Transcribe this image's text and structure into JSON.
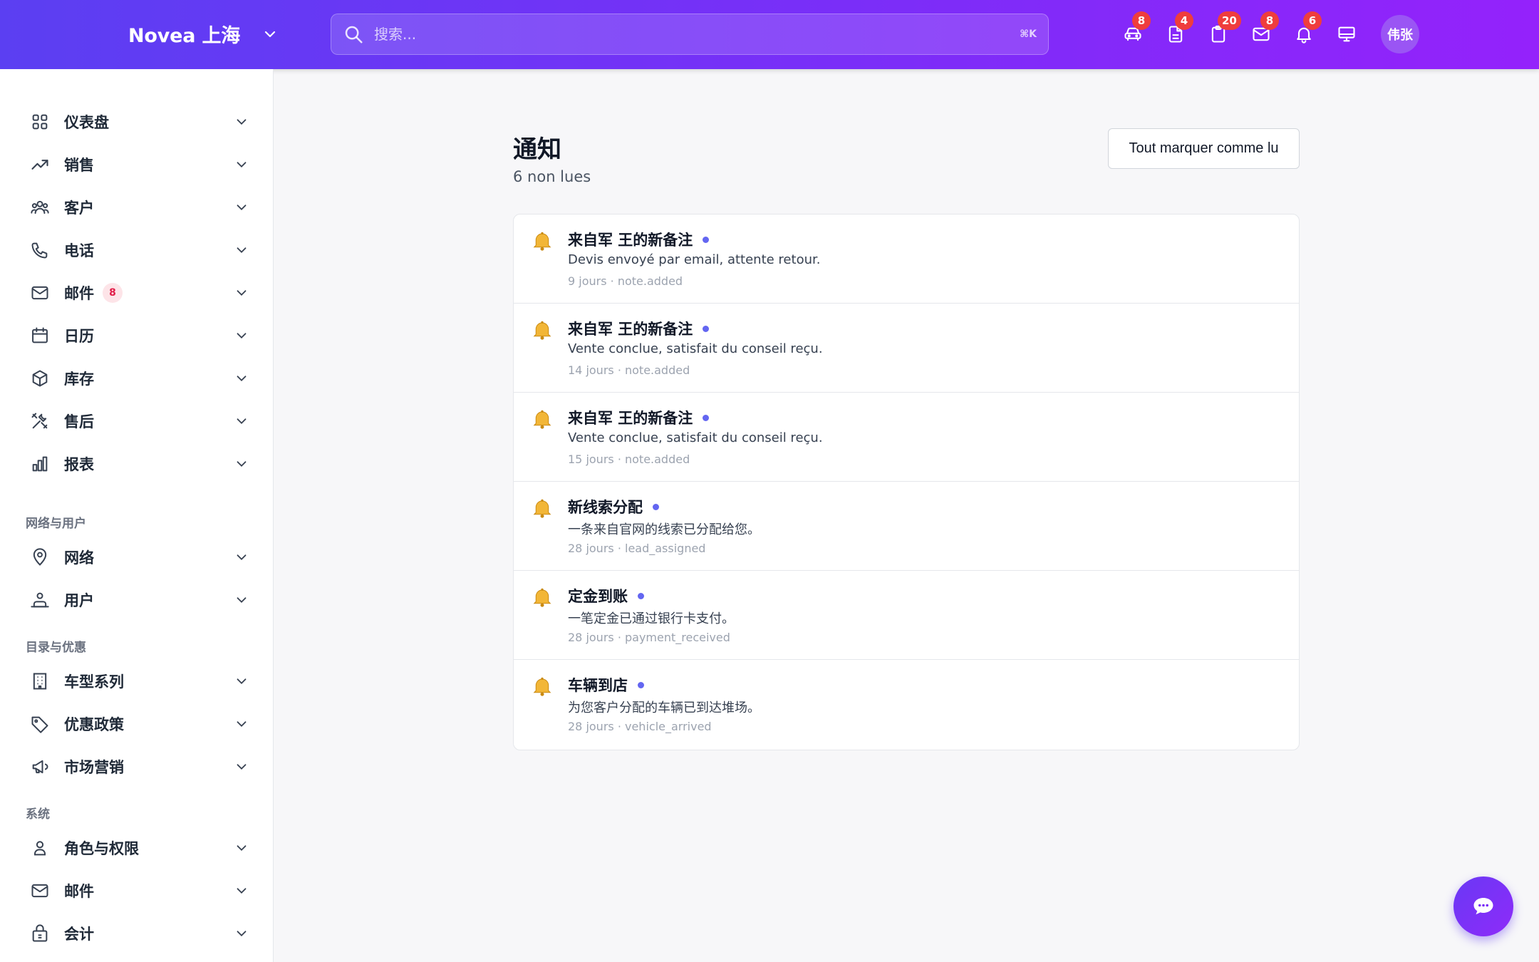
{
  "header": {
    "brand": "Novea 上海",
    "search_placeholder": "搜索...",
    "search_shortcut": "⌘K",
    "icons": [
      {
        "name": "car-icon",
        "badge": "8"
      },
      {
        "name": "document-icon",
        "badge": "4"
      },
      {
        "name": "clipboard-icon",
        "badge": "20"
      },
      {
        "name": "mail-icon",
        "badge": "8"
      },
      {
        "name": "bell-icon",
        "badge": "6"
      },
      {
        "name": "monitor-icon",
        "badge": ""
      }
    ],
    "avatar": "伟张"
  },
  "sidebar": {
    "items": [
      {
        "label": "仪表盘",
        "icon": "grid-icon"
      },
      {
        "label": "销售",
        "icon": "trending-icon"
      },
      {
        "label": "客户",
        "icon": "users-icon"
      },
      {
        "label": "电话",
        "icon": "phone-icon"
      },
      {
        "label": "邮件",
        "icon": "mail-icon",
        "badge": "8"
      },
      {
        "label": "日历",
        "icon": "calendar-icon"
      },
      {
        "label": "库存",
        "icon": "box-icon"
      },
      {
        "label": "售后",
        "icon": "tools-icon"
      },
      {
        "label": "报表",
        "icon": "bar-chart-icon"
      }
    ],
    "section_network": "网络与用户",
    "network_items": [
      {
        "label": "网络",
        "icon": "map-pin-icon"
      },
      {
        "label": "用户",
        "icon": "user-group-icon"
      }
    ],
    "section_catalog": "目录与优惠",
    "catalog_items": [
      {
        "label": "车型系列",
        "icon": "building-icon"
      },
      {
        "label": "优惠政策",
        "icon": "tag-icon"
      },
      {
        "label": "市场营销",
        "icon": "megaphone-icon"
      }
    ],
    "section_system": "系统",
    "system_items": [
      {
        "label": "角色与权限",
        "icon": "user-icon"
      },
      {
        "label": "邮件",
        "icon": "mail-icon"
      },
      {
        "label": "会计",
        "icon": "lock-bag-icon"
      }
    ]
  },
  "main": {
    "title": "通知",
    "subtitle": "6 non lues",
    "mark_all_button": "Tout marquer comme lu",
    "notifications": [
      {
        "title": "来自军 王的新备注",
        "body": "Devis envoyé par email, attente retour.",
        "meta": "9 jours · note.added"
      },
      {
        "title": "来自军 王的新备注",
        "body": "Vente conclue, satisfait du conseil reçu.",
        "meta": "14 jours · note.added"
      },
      {
        "title": "来自军 王的新备注",
        "body": "Vente conclue, satisfait du conseil reçu.",
        "meta": "15 jours · note.added"
      },
      {
        "title": "新线索分配",
        "body": "一条来自官网的线索已分配给您。",
        "meta": "28 jours · lead_assigned"
      },
      {
        "title": "定金到账",
        "body": "一笔定金已通过银行卡支付。",
        "meta": "28 jours · payment_received"
      },
      {
        "title": "车辆到店",
        "body": "为您客户分配的车辆已到达堆场。",
        "meta": "28 jours · vehicle_arrived"
      }
    ]
  },
  "colors": {
    "header_start": "#5b3ff2",
    "header_end": "#9422fb",
    "unread_dot": "#6366f1",
    "badge": "#ef3d3d"
  }
}
